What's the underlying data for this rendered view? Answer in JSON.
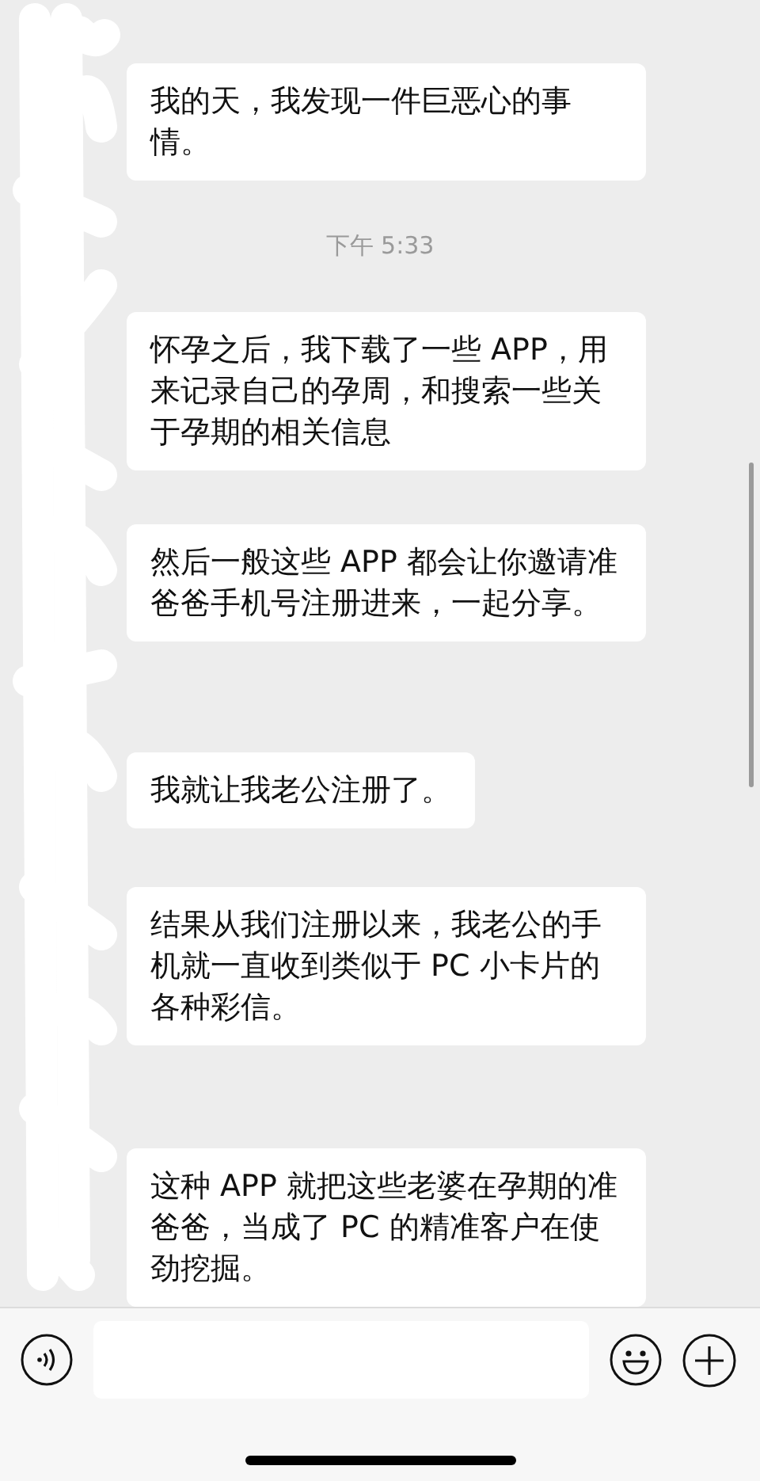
{
  "chat": [
    {
      "kind": "message",
      "text": "我的天，我发现一件巨恶心的事情。"
    },
    {
      "kind": "time",
      "text": "下午 5:33"
    },
    {
      "kind": "message",
      "text": "怀孕之后，我下载了一些 APP，用来记录自己的孕周，和搜索一些关于孕期的相关信息"
    },
    {
      "kind": "message",
      "text": "然后一般这些 APP 都会让你邀请准爸爸手机号注册进来，一起分享。"
    },
    {
      "kind": "message",
      "text": "我就让我老公注册了。"
    },
    {
      "kind": "message",
      "text": "结果从我们注册以来，我老公的手机就一直收到类似于 PC 小卡片的各种彩信。"
    },
    {
      "kind": "message",
      "text": "这种 APP 就把这些老婆在孕期的准爸爸，当成了 PC 的精准客户在使劲挖掘。"
    }
  ]
}
